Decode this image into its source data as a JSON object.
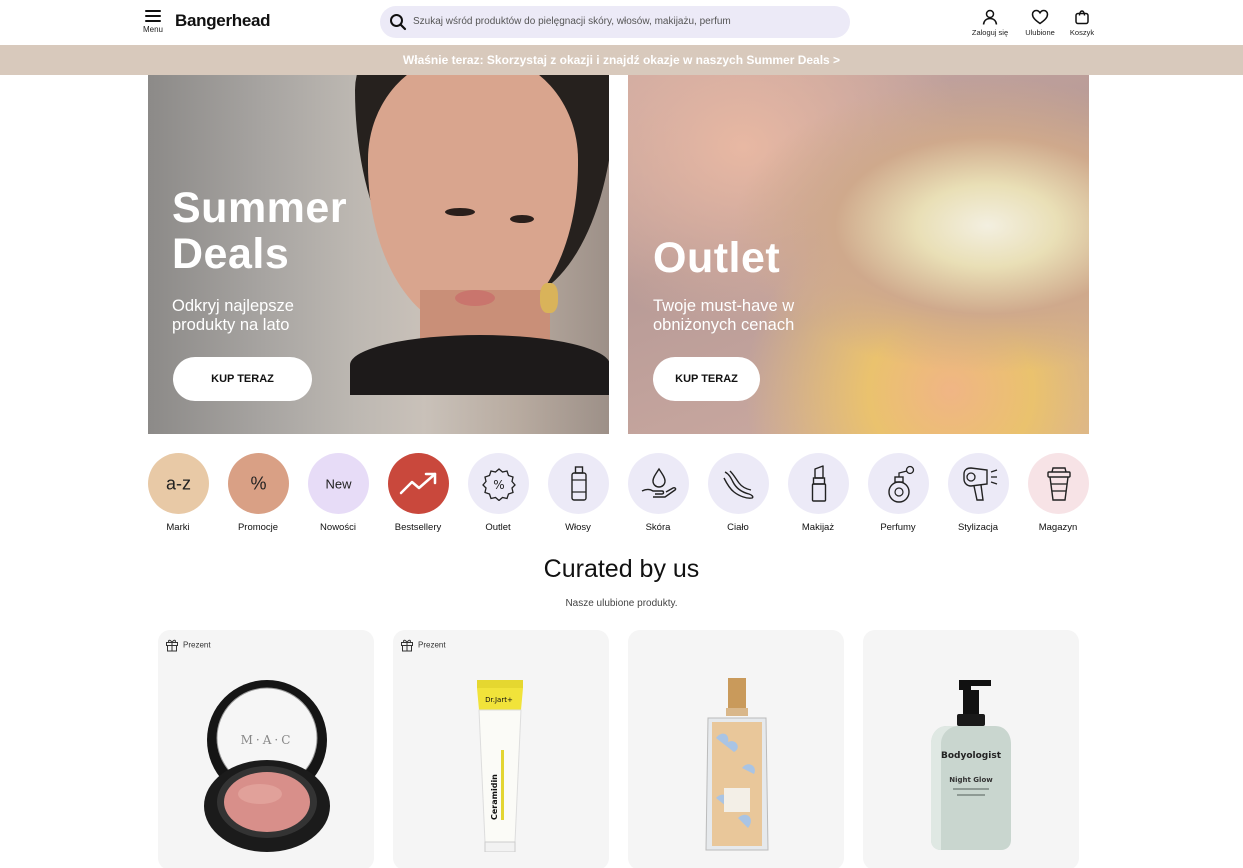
{
  "header": {
    "menu_label": "Menu",
    "logo": "Bangerhead",
    "search_placeholder": "Szukaj wśród produktów do pielęgnacji skóry, włosów, makijażu, perfum",
    "login_label": "Zaloguj się",
    "favorites_label": "Ulubione",
    "cart_label": "Koszyk"
  },
  "promo_bar": {
    "text": "Właśnie teraz: Skorzystaj z okazji i znajdź okazje w naszych Summer Deals >"
  },
  "hero": {
    "left": {
      "title_line1": "Summer",
      "title_line2": "Deals",
      "subtitle_line1": "Odkryj najlepsze",
      "subtitle_line2": "produkty na lato",
      "button": "KUP TERAZ"
    },
    "right": {
      "title": "Outlet",
      "subtitle_line1": "Twoje must-have w",
      "subtitle_line2": "obniżonych cenach",
      "button": "KUP TERAZ"
    }
  },
  "categories": [
    {
      "label": "Marki",
      "icon": "a-z-text",
      "glyph": "a-z",
      "color": "#e8c9a6"
    },
    {
      "label": "Promocje",
      "icon": "percent-text",
      "glyph": "%",
      "color": "#d9a085"
    },
    {
      "label": "Nowości",
      "icon": "new-text",
      "glyph": "New",
      "color": "#e7dcf7"
    },
    {
      "label": "Bestsellery",
      "icon": "trend-up-icon",
      "color": "#c9483c"
    },
    {
      "label": "Outlet",
      "icon": "percent-badge-icon",
      "color": "#eceaf7"
    },
    {
      "label": "Włosy",
      "icon": "bottle-icon",
      "color": "#eceaf7"
    },
    {
      "label": "Skóra",
      "icon": "drop-hand-icon",
      "color": "#eceaf7"
    },
    {
      "label": "Ciało",
      "icon": "legs-icon",
      "color": "#eceaf7"
    },
    {
      "label": "Makijaż",
      "icon": "lipstick-icon",
      "color": "#eceaf7"
    },
    {
      "label": "Perfumy",
      "icon": "perfume-icon",
      "color": "#eceaf7"
    },
    {
      "label": "Stylizacja",
      "icon": "hairdryer-icon",
      "color": "#eceaf7"
    },
    {
      "label": "Magazyn",
      "icon": "coffee-cup-icon",
      "color": "#f7e3e6"
    }
  ],
  "curated": {
    "title": "Curated by us",
    "subtitle": "Nasze ulubione produkty."
  },
  "products": [
    {
      "badge": "Prezent",
      "image": "blush-compact-icon",
      "brand_mark": "M·A·C"
    },
    {
      "badge": "Prezent",
      "image": "cream-tube-icon",
      "brand_mark": "Dr.Jart+",
      "product_mark": "Ceramidin"
    },
    {
      "badge": "",
      "image": "perfume-bottle-icon"
    },
    {
      "badge": "",
      "image": "pump-bottle-icon",
      "brand_mark": "Bodyologist",
      "product_mark": "Night Glow"
    }
  ],
  "colors": {
    "promo_bg": "#d8c9bc",
    "search_bg": "#eceaf7",
    "card_bg": "#f5f5f5",
    "bestseller_red": "#c9483c"
  }
}
